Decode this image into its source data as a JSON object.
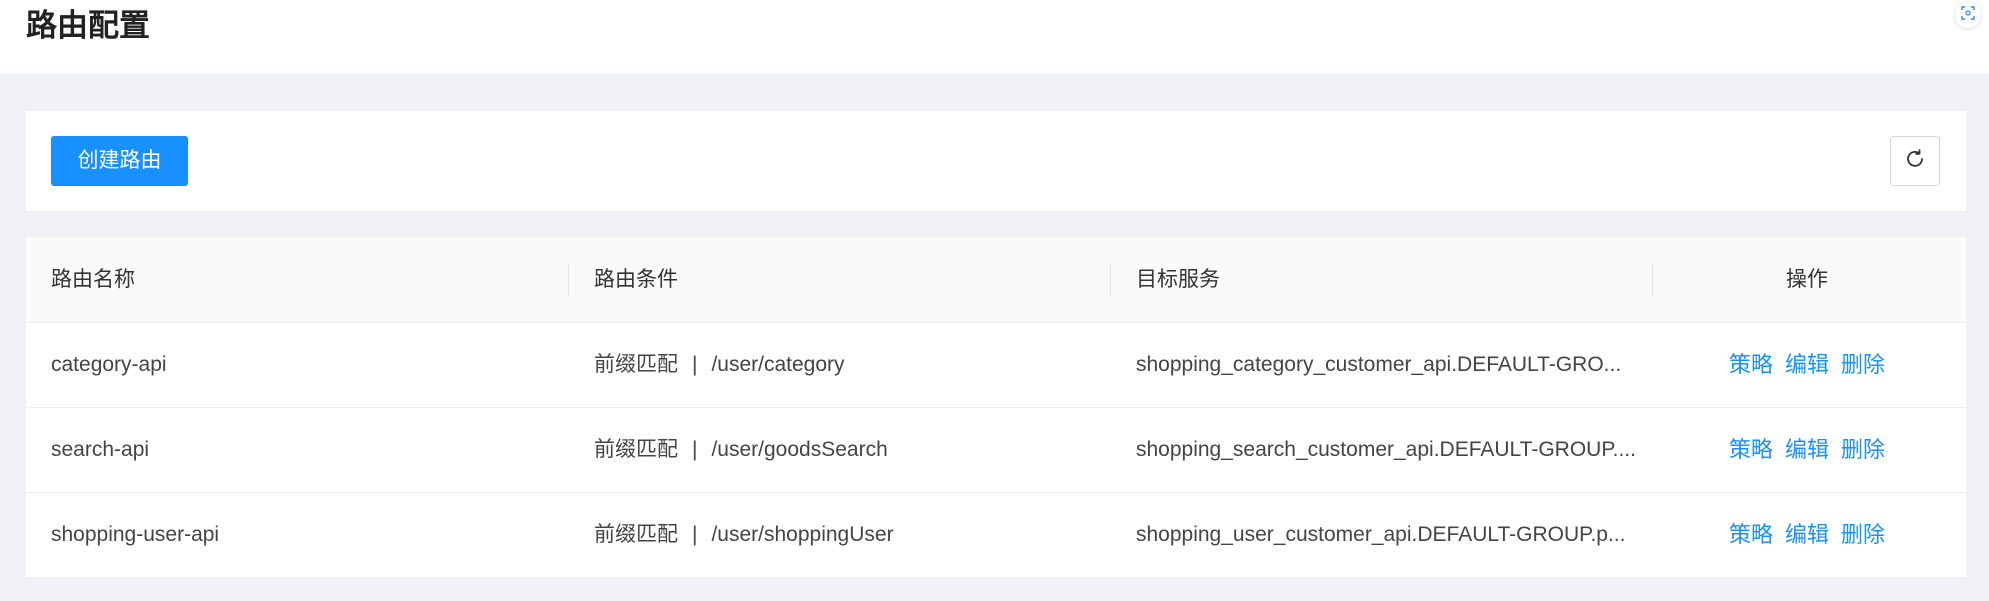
{
  "header": {
    "title": "路由配置"
  },
  "toolbar": {
    "create_label": "创建路由"
  },
  "table": {
    "columns": [
      "路由名称",
      "路由条件",
      "目标服务",
      "操作"
    ],
    "rows": [
      {
        "name": "category-api",
        "match_type": "前缀匹配",
        "separator": "|",
        "path": "/user/category",
        "service": "shopping_category_customer_api.DEFAULT-GRO...",
        "ops": [
          "策略",
          "编辑",
          "删除"
        ]
      },
      {
        "name": "search-api",
        "match_type": "前缀匹配",
        "separator": "|",
        "path": "/user/goodsSearch",
        "service": "shopping_search_customer_api.DEFAULT-GROUP....",
        "ops": [
          "策略",
          "编辑",
          "删除"
        ]
      },
      {
        "name": "shopping-user-api",
        "match_type": "前缀匹配",
        "separator": "|",
        "path": "/user/shoppingUser",
        "service": "shopping_user_customer_api.DEFAULT-GROUP.p...",
        "ops": [
          "策略",
          "编辑",
          "删除"
        ]
      }
    ]
  },
  "icons": {
    "refresh": "refresh-icon",
    "fullscreen": "fullscreen-icon"
  },
  "colors": {
    "primary": "#1890ff",
    "background": "#f0f1f4",
    "table_header": "#fafafa"
  }
}
